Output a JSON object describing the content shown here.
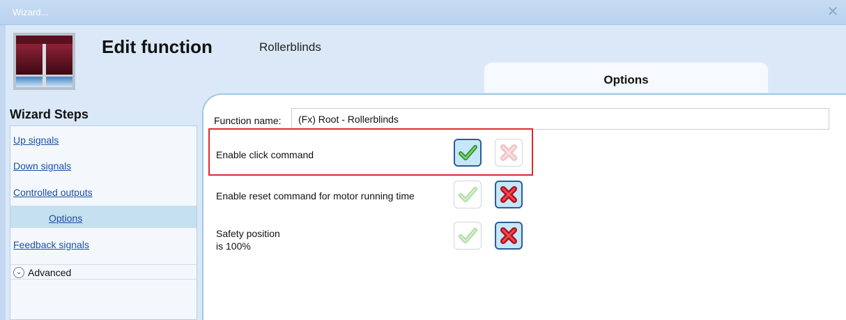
{
  "window": {
    "title": "Wizard...",
    "close_glyph": "✕"
  },
  "header": {
    "title": "Edit function",
    "subtitle": "Rollerblinds",
    "icon": "rollerblind-icon"
  },
  "tabs": [
    {
      "label": "Options",
      "selected": true
    }
  ],
  "sidebar": {
    "heading": "Wizard Steps",
    "items": [
      {
        "label": "Up signals",
        "active": false
      },
      {
        "label": "Down signals",
        "active": false
      },
      {
        "label": "Controlled outputs",
        "active": false
      },
      {
        "label": "Options",
        "active": true
      },
      {
        "label": "Feedback signals",
        "active": false
      }
    ],
    "advanced": {
      "label": "Advanced",
      "icon": "chevron-down-icon"
    }
  },
  "form": {
    "function_name_label": "Function name:",
    "function_name_value": "(Fx) Root - Rollerblinds",
    "options": [
      {
        "label": "Enable click command",
        "enabled": true
      },
      {
        "label": "Enable reset command for motor running time",
        "enabled": false
      },
      {
        "label_lines": [
          "Safety position",
          "is 100%"
        ],
        "enabled": false
      }
    ]
  },
  "colors": {
    "accent_red_highlight": "#e0282e",
    "link": "#1b4fa6",
    "selected_button_bg": "#c6e6fb",
    "panel_border": "#9fc8e6"
  }
}
